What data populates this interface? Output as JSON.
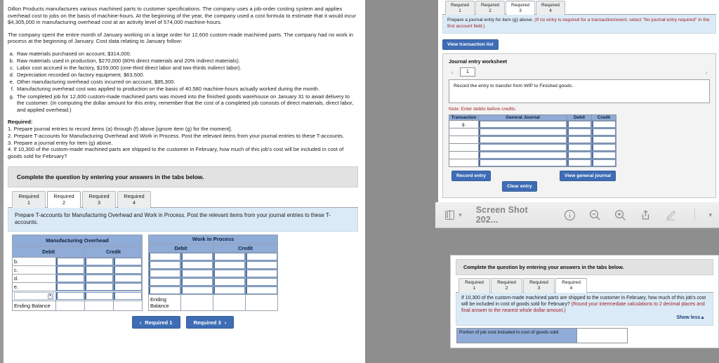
{
  "document": {
    "paragraphs": [
      "Dillon Products manufactures various machined parts to customer specifications. The company uses a job-order costing system and applies overhead cost to jobs on the basis of machine-hours. At the beginning of the year, the company used a cost formula to estimate that it would incur $4,305,000 in manufacturing overhead cost at an activity level of 574,000 machine-hours.",
      "The company spent the entire month of January working on a large order for 12,600 custom-made machined parts. The company had no work in process at the beginning of January. Cost data relating to January follow:"
    ],
    "items": [
      {
        "marker": "a.",
        "text": "Raw materials purchased on account, $314,000."
      },
      {
        "marker": "b.",
        "text": "Raw materials used in production, $270,000 (80% direct materials and 20% indirect materials)."
      },
      {
        "marker": "c.",
        "text": "Labor cost accrued in the factory, $159,000 (one-third direct labor and two-thirds indirect labor)."
      },
      {
        "marker": "d.",
        "text": "Depreciation recorded on factory equipment, $63,500."
      },
      {
        "marker": "e.",
        "text": "Other manufacturing overhead costs incurred on account, $85,300."
      },
      {
        "marker": "f.",
        "text": "Manufacturing overhead cost was applied to production on the basis of 40,580 machine-hours actually worked during the month."
      },
      {
        "marker": "g.",
        "text": "The completed job for 12,600 custom-made machined parts was moved into the finished goods warehouse on January 31 to await delivery to the customer. (In computing the dollar amount for this entry, remember that the cost of a completed job consists of direct materials, direct labor, and applied overhead.)"
      }
    ],
    "required_heading": "Required:",
    "required_lines": [
      "1. Prepare journal entries to record items (a) through (f) above [ignore item (g) for the moment].",
      "2. Prepare T-accounts for Manufacturing Overhead and Work in Process. Post the relevant items from your journal entries to these T-accounts.",
      "3. Prepare a journal entry for item (g) above.",
      "4. If 10,300 of the custom-made machined parts are shipped to the customer in February, how much of this job's cost will be included in cost of goods sold for February?"
    ]
  },
  "left_panel": {
    "banner": "Complete the question by entering your answers in the tabs below.",
    "tabs": [
      {
        "line1": "Required",
        "line2": "1",
        "active": false
      },
      {
        "line1": "Required",
        "line2": "2",
        "active": true
      },
      {
        "line1": "Required",
        "line2": "3",
        "active": false
      },
      {
        "line1": "Required",
        "line2": "4",
        "active": false
      }
    ],
    "tab_instruction": "Prepare T-accounts for Manufacturing Overhead and Work in Process. Post the relevant items from your journal entries to these T-accounts.",
    "t_accounts": [
      {
        "title": "Manufacturing Overhead",
        "debit_header": "Debit",
        "credit_header": "Credit",
        "rows": [
          "b.",
          "c.",
          "d.",
          "e."
        ],
        "has_dropdown_row": true,
        "ending_label": "Ending Balance"
      },
      {
        "title": "Work in Process",
        "debit_header": "Debit",
        "credit_header": "Credit",
        "rows": [
          "",
          "",
          "",
          ""
        ],
        "has_dropdown_row": false,
        "ending_label": "Ending Balance"
      }
    ],
    "nav": {
      "prev_label": "Required 1",
      "next_label": "Required 3",
      "prev_glyph": "‹",
      "next_glyph": "›"
    }
  },
  "top_right_panel": {
    "tabs": [
      {
        "line1": "Required",
        "line2": "1",
        "active": false
      },
      {
        "line1": "Required",
        "line2": "2",
        "active": false
      },
      {
        "line1": "Required",
        "line2": "3",
        "active": true
      },
      {
        "line1": "Required",
        "line2": "4",
        "active": false
      }
    ],
    "instruction_black": "Prepare a journal entry for item (g) above.",
    "instruction_red": "(If no entry is required for a transaction/event, select \"No journal entry required\" in the first account field.)",
    "view_transaction_list": "View transaction list",
    "worksheet_title": "Journal entry worksheet",
    "worksheet_page": "1",
    "worksheet_description": "Record the entry to transfer from WIP to Finished goods.",
    "note": "Note: Enter debits before credits.",
    "journal_headers": [
      "Transaction",
      "General Journal",
      "Debit",
      "Credit"
    ],
    "journal_rows": [
      {
        "transaction": "g."
      },
      {
        "transaction": ""
      },
      {
        "transaction": ""
      },
      {
        "transaction": ""
      },
      {
        "transaction": ""
      },
      {
        "transaction": ""
      }
    ],
    "record_entry": "Record entry",
    "clear_entry": "Clear entry",
    "view_general_journal": "View general journal"
  },
  "preview_toolbar": {
    "title": "Screen Shot 202...",
    "icons": [
      "sidebar-icon",
      "chevron-down-icon",
      "info-icon",
      "zoom-out-icon",
      "zoom-in-icon",
      "share-icon",
      "markup-icon",
      "chevron-down-icon"
    ]
  },
  "bottom_right_panel": {
    "banner": "Complete the question by entering your answers in the tabs below.",
    "tabs": [
      {
        "line1": "Required",
        "line2": "1",
        "active": false
      },
      {
        "line1": "Required",
        "line2": "2",
        "active": false
      },
      {
        "line1": "Required",
        "line2": "3",
        "active": false
      },
      {
        "line1": "Required",
        "line2": "4",
        "active": true
      }
    ],
    "question_black": "If 10,300 of the custom-made machined parts are shipped to the customer in February, how much of this job's cost will be included in cost of goods sold for February?",
    "question_red": "(Round your intermediate calculations to 2 decimal places and final answer to the nearest whole dollar amount.)",
    "show_less": "Show less",
    "show_less_glyph": "▲",
    "answer_label": "Portion of job cost included in cost of goods sold",
    "answer_value": ""
  },
  "colors": {
    "table_header_blue": "#8fabd8",
    "button_blue": "#3f6db5",
    "info_panel_blue": "#dbeaf7",
    "banner_gray": "#e2e2e2",
    "desktop_gray": "#8e8e8e",
    "red_text": "#a32020"
  }
}
